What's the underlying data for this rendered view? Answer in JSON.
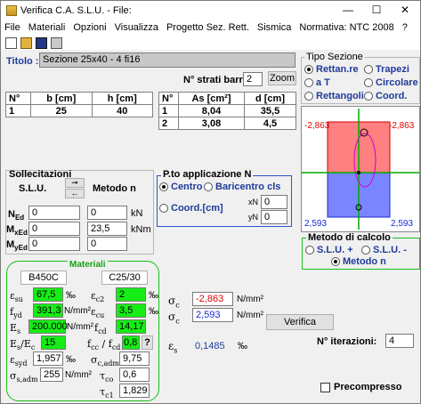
{
  "window": {
    "title": "Verifica C.A. S.L.U. - File:"
  },
  "menu": [
    "File",
    "Materiali",
    "Opzioni",
    "Visualizza",
    "Progetto Sez. Rett.",
    "Sismica",
    "Normativa: NTC 2008",
    "?"
  ],
  "toolbar_icons": [
    "new-file-icon",
    "open-folder-icon",
    "save-icon",
    "print-icon"
  ],
  "titolo": {
    "label": "Titolo :",
    "value": "Sezione 25x40 - 4 fi16"
  },
  "strati": {
    "label": "N° strati barre",
    "value": "2",
    "zoom": "Zoom"
  },
  "tipo_sezione": {
    "title": "Tipo Sezione",
    "options": [
      "Rettan.re",
      "Trapezi",
      "a T",
      "Circolare",
      "Rettangoli",
      "Coord."
    ],
    "selected": "Rettan.re"
  },
  "section_table": {
    "headers": [
      "N°",
      "b [cm]",
      "h [cm]"
    ],
    "rows": [
      [
        "1",
        "25",
        "40"
      ]
    ]
  },
  "bars_table": {
    "headers": [
      "N°",
      "As [cm²]",
      "d [cm]"
    ],
    "rows": [
      [
        "1",
        "8,04",
        "35,5"
      ],
      [
        "2",
        "3,08",
        "4,5"
      ]
    ]
  },
  "drawing": {
    "top_left": "-2,863",
    "top_right": "-2,863",
    "bottom_left": "2,593",
    "bottom_right": "2,593"
  },
  "sollecitazioni": {
    "title": "Sollecitazioni",
    "slu": "S.L.U.",
    "metodo": "Metodo n",
    "rows": [
      {
        "label": "N",
        "sub": "Ed",
        "slu": "0",
        "n": "0",
        "unit": "kN"
      },
      {
        "label": "M",
        "sub": "xEd",
        "slu": "0",
        "n": "23,5",
        "unit": "kNm"
      },
      {
        "label": "M",
        "sub": "yEd",
        "slu": "0",
        "n": "0",
        "unit": ""
      }
    ]
  },
  "punto_applicazione": {
    "title": "P.to applicazione N",
    "options": [
      "Centro",
      "Baricentro cls",
      "Coord.[cm]"
    ],
    "selected": "Centro",
    "xN": {
      "label": "xN",
      "value": "0"
    },
    "yN": {
      "label": "yN",
      "value": "0"
    }
  },
  "metodo_calcolo": {
    "title": "Metodo di calcolo",
    "options": [
      "S.L.U. +",
      "S.L.U. -",
      "Metodo n"
    ],
    "selected": "Metodo n"
  },
  "materiali": {
    "title": "Materiali",
    "steel": "B450C",
    "concrete": "C25/30",
    "esu": "67,5",
    "esu_unit": "‰",
    "ec2": "2",
    "ec2_unit": "‰",
    "fyd": "391,3",
    "fyd_unit": "N/mm²",
    "ecu": "3,5",
    "ecu_unit": "‰",
    "Es": "200.000",
    "Es_unit": "N/mm²",
    "fcd": "14,17",
    "ratio": "15",
    "fcc": "0,8",
    "q": "?",
    "esyd": "1,957",
    "esyd_unit": "‰",
    "scadm": "9,75",
    "ssadm": "255",
    "ssadm_unit": "N/mm²",
    "tc0": "0,6",
    "tc1": "1,829"
  },
  "results": {
    "sc_top": "-2,863",
    "sc_bottom": "2,593",
    "sc_unit": "N/mm²",
    "es": "0,1485",
    "es_unit": "‰",
    "verifica": "Verifica",
    "iterazioni_label": "N° iterazioni:",
    "iterazioni": "4",
    "precompresso": "Precompresso"
  },
  "colors": {
    "green": "#16ec16",
    "red": "#e00000",
    "blue": "#1f3a9a",
    "magenta": "#cc00cc"
  }
}
